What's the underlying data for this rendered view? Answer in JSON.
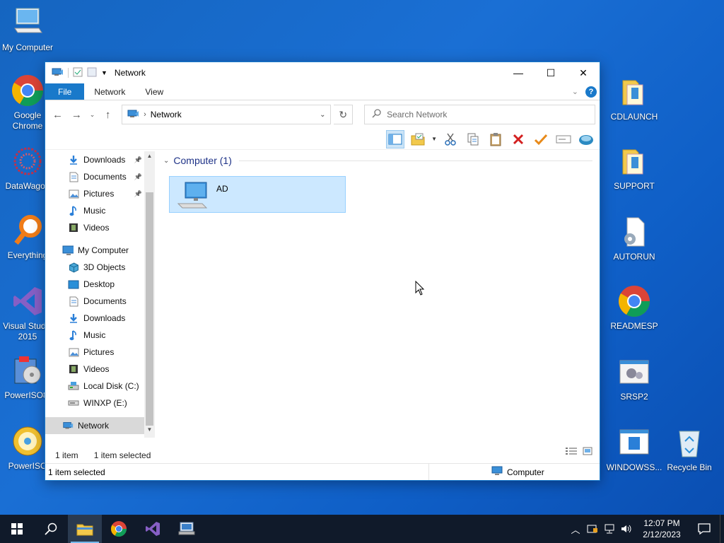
{
  "desktop_left": [
    {
      "label": "My Computer",
      "icon": "computer-icon"
    },
    {
      "label": "Google Chrome",
      "icon": "chrome-icon"
    },
    {
      "label": "DataWagon",
      "icon": "datawagon-icon"
    },
    {
      "label": "Everything",
      "icon": "everything-search-icon"
    },
    {
      "label": "Visual Studio 2015",
      "icon": "visual-studio-icon"
    },
    {
      "label": "PowerISO8-",
      "icon": "poweriso-installer-icon"
    },
    {
      "label": "PowerISO",
      "icon": "poweriso-disc-icon"
    }
  ],
  "desktop_right": [
    {
      "label": "CDLAUNCH",
      "icon": "folder-icon"
    },
    {
      "label": "SUPPORT",
      "icon": "folder-icon"
    },
    {
      "label": "AUTORUN",
      "icon": "settings-file-icon"
    },
    {
      "label": "READMESP",
      "icon": "chrome-icon"
    },
    {
      "label": "SRSP2",
      "icon": "gears-window-icon"
    },
    {
      "label": "WINDOWSS...",
      "icon": "window-file-icon"
    },
    {
      "label": "Recycle Bin",
      "icon": "recycle-bin-icon"
    }
  ],
  "window": {
    "title": "Network",
    "tabs": {
      "file": "File",
      "network": "Network",
      "view": "View"
    },
    "address": "Network",
    "search_placeholder": "Search Network",
    "nav": [
      {
        "label": "Downloads",
        "icon": "download-arrow-icon",
        "pinned": true,
        "indent": 32
      },
      {
        "label": "Documents",
        "icon": "document-icon",
        "pinned": true,
        "indent": 32
      },
      {
        "label": "Pictures",
        "icon": "pictures-icon",
        "pinned": true,
        "indent": 32
      },
      {
        "label": "Music",
        "icon": "music-note-icon",
        "pinned": false,
        "indent": 32
      },
      {
        "label": "Videos",
        "icon": "film-icon",
        "pinned": false,
        "indent": 32
      },
      {
        "label": "My Computer",
        "icon": "computer-icon",
        "pinned": false,
        "indent": 24
      },
      {
        "label": "3D Objects",
        "icon": "cube-icon",
        "pinned": false,
        "indent": 32
      },
      {
        "label": "Desktop",
        "icon": "desktop-icon",
        "pinned": false,
        "indent": 32
      },
      {
        "label": "Documents",
        "icon": "document-icon",
        "pinned": false,
        "indent": 32
      },
      {
        "label": "Downloads",
        "icon": "download-arrow-icon",
        "pinned": false,
        "indent": 32
      },
      {
        "label": "Music",
        "icon": "music-note-icon",
        "pinned": false,
        "indent": 32
      },
      {
        "label": "Pictures",
        "icon": "pictures-icon",
        "pinned": false,
        "indent": 32
      },
      {
        "label": "Videos",
        "icon": "film-icon",
        "pinned": false,
        "indent": 32
      },
      {
        "label": "Local Disk (C:)",
        "icon": "hard-drive-icon",
        "pinned": false,
        "indent": 32
      },
      {
        "label": "WINXP (E:)",
        "icon": "optical-drive-icon",
        "pinned": false,
        "indent": 32
      },
      {
        "label": "Network",
        "icon": "network-icon",
        "pinned": false,
        "indent": 24,
        "selected": true
      }
    ],
    "group_header": "Computer (1)",
    "item": {
      "label": "AD"
    },
    "item_count": "1 item",
    "selected_count": "1 item selected",
    "status_left": "1 item selected",
    "status_zone": "Computer"
  },
  "taskbar": {
    "time": "12:07 PM",
    "date": "2/12/2023"
  },
  "colors": {
    "accent": "#1979ca",
    "selection": "#cce8ff",
    "taskbar": "#101a2a"
  }
}
